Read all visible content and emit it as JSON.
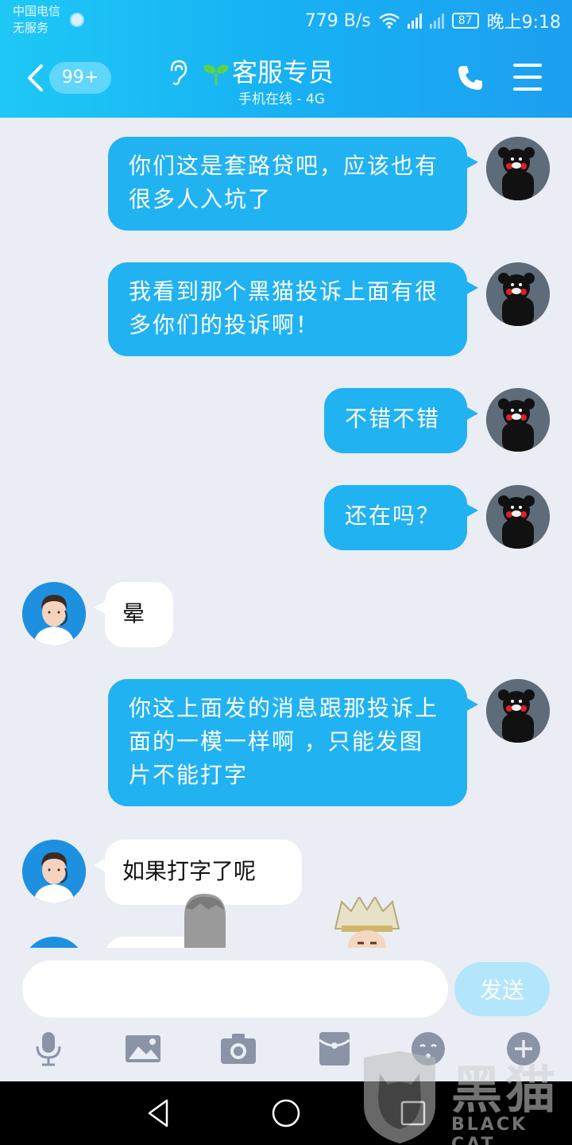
{
  "status_bar": {
    "carrier": "中国电信",
    "service": "无服务",
    "net_speed": "779 B/s",
    "battery": "87",
    "time": "晚上9:18"
  },
  "header": {
    "unread_badge": "99+",
    "title": "客服专员",
    "subtitle": "手机在线 - 4G"
  },
  "messages": [
    {
      "side": "out",
      "text": "你们这是套路贷吧，应该也有很多人入坑了"
    },
    {
      "side": "out",
      "text": "我看到那个黑猫投诉上面有很多你们的投诉啊！"
    },
    {
      "side": "out",
      "text": "不错不错"
    },
    {
      "side": "out",
      "text": "还在吗？"
    },
    {
      "side": "in",
      "text": "晕"
    },
    {
      "side": "out",
      "text": "你这上面发的消息跟那投诉上面的一模一样啊 ，只能发图片不能打字"
    },
    {
      "side": "in",
      "text": "如果打字了呢"
    }
  ],
  "input": {
    "value": "",
    "placeholder": "",
    "send_label": "发送"
  },
  "toolbar": [
    "mic-icon",
    "image-icon",
    "camera-icon",
    "red-packet-icon",
    "emoji-icon",
    "plus-icon"
  ],
  "watermark": {
    "brand": "黑猫",
    "sub": "BLACK CAT"
  },
  "colors": {
    "header": "#1ab4f3",
    "bubble_out": "#21b2f2",
    "background": "#eaedf4",
    "send_disabled": "#b3e6fb"
  }
}
